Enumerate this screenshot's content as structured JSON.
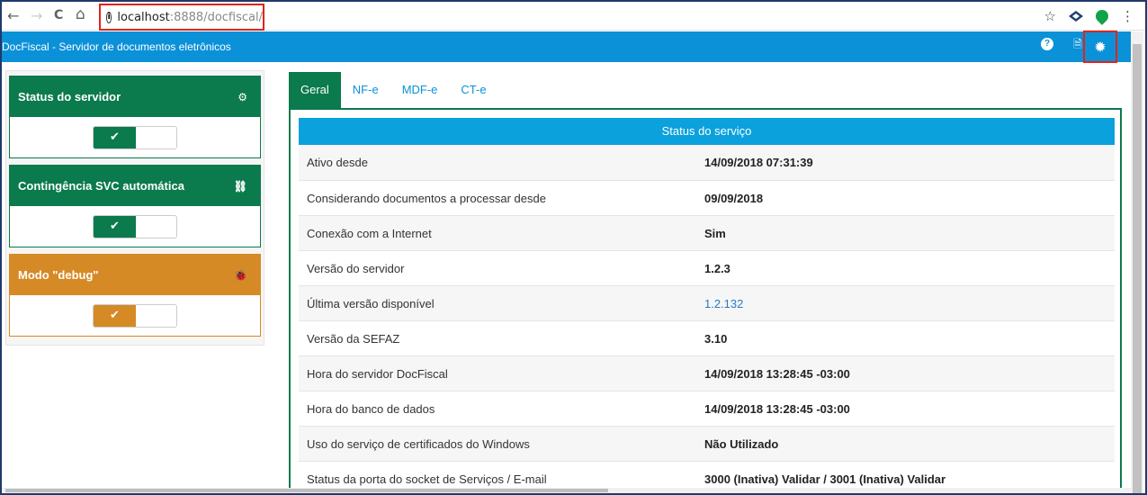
{
  "browser": {
    "url_host": "localhost",
    "url_port_path": ":8888/docfiscal/",
    "back_icon": "←",
    "forward_icon": "→",
    "reload_icon": "C",
    "home_icon": "⌂",
    "star_icon": "☆",
    "menu_icon": "⋮"
  },
  "header": {
    "title": "DocFiscal - Servidor de documentos eletrônicos",
    "help_icon": "?",
    "doc_icon": "🗎",
    "gear_icon": "✹"
  },
  "sidebar": {
    "cards": [
      {
        "title": "Status do servidor",
        "icon": "⚙",
        "state": "on",
        "color": "green",
        "check": "✔"
      },
      {
        "title": "Contingência SVC automática",
        "icon": "⛓",
        "state": "on",
        "color": "green",
        "check": "✔"
      },
      {
        "title": "Modo \"debug\"",
        "icon": "🐞",
        "state": "on",
        "color": "orange",
        "check": "✔"
      }
    ]
  },
  "tabs": [
    "Geral",
    "NF-e",
    "MDF-e",
    "CT-e"
  ],
  "panel": {
    "title": "Status do serviço",
    "rows": [
      {
        "label": "Ativo desde",
        "value": "14/09/2018 07:31:39"
      },
      {
        "label": "Considerando documentos a processar desde",
        "value": "09/09/2018"
      },
      {
        "label": "Conexão com a Internet",
        "value": "Sim"
      },
      {
        "label": "Versão do servidor",
        "value": "1.2.3"
      },
      {
        "label": "Última versão disponível",
        "value": "1.2.132"
      },
      {
        "label": "Versão da SEFAZ",
        "value": "3.10"
      },
      {
        "label": "Hora do servidor DocFiscal",
        "value": "14/09/2018 13:28:45 -03:00"
      },
      {
        "label": "Hora do banco de dados",
        "value": "14/09/2018 13:28:45 -03:00"
      },
      {
        "label": "Uso do serviço de certificados do Windows",
        "value": "Não Utilizado"
      },
      {
        "label": "Status da porta do socket de Serviços / E-mail",
        "value": "3000 (Inativa) Validar / 3001 (Inativa) Validar"
      }
    ]
  },
  "colors": {
    "header_blue": "#0b91d8",
    "green": "#0b7a4d",
    "orange": "#d58a26",
    "link": "#2a7ac2"
  }
}
